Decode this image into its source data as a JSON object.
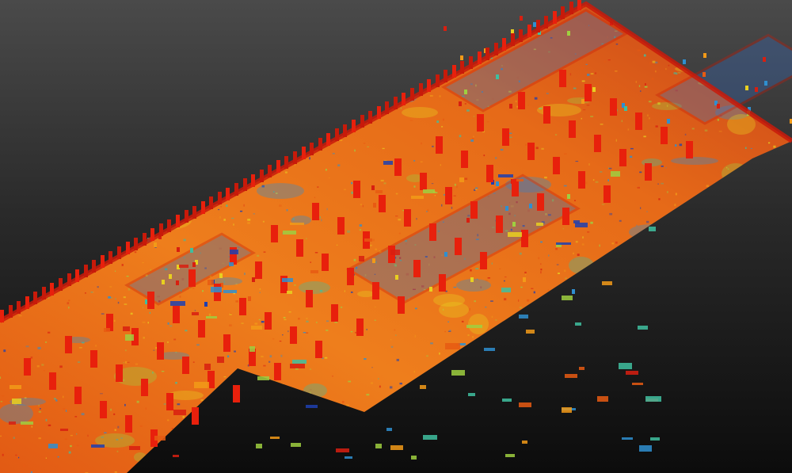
{
  "scene": {
    "type": "point-cloud-intensity-render",
    "view": "isometric",
    "subject": "warehouse-floor-plan-scan"
  },
  "colors": {
    "background_top": "#4a4a4a",
    "background_bottom": "#0c0c0c",
    "ramp": [
      "#1f3fb0",
      "#2f8fd0",
      "#3fbfa0",
      "#9fcf40",
      "#e8d020",
      "#f29a18",
      "#e85a12",
      "#d81f10"
    ],
    "column": "#e8200c",
    "wall": "#c81a0a",
    "floor_base": "#e8731a"
  }
}
